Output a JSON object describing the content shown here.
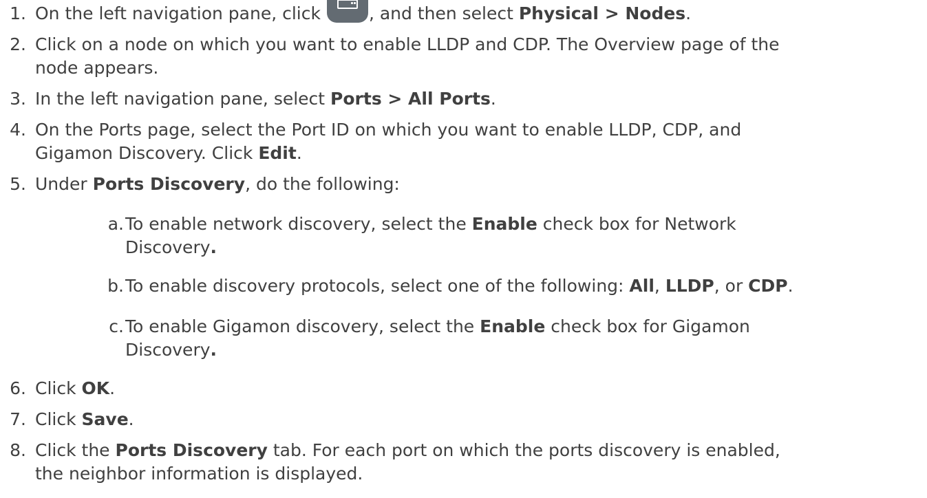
{
  "steps": [
    {
      "num": "1.",
      "a": "On the left navigation pane, click ",
      "b": ", and then select ",
      "c": "Physical > Nodes",
      "d": "."
    },
    {
      "num": "2.",
      "line1": "Click on a node on which you want to enable LLDP and CDP. The Overview page of the",
      "line2": "node appears."
    },
    {
      "num": "3.",
      "a": "In the left navigation pane, select ",
      "b": "Ports > All Ports",
      "c": "."
    },
    {
      "num": "4.",
      "line1": "On the Ports page, select the Port ID on which you want to enable LLDP, CDP, and",
      "line2a": "Gigamon Discovery. Click ",
      "line2b": "Edit",
      "line2c": "."
    },
    {
      "num": "5.",
      "a": "Under ",
      "b": "Ports Discovery",
      "c": ", do the following:"
    },
    {
      "num": "6.",
      "a": "Click ",
      "b": "OK",
      "c": "."
    },
    {
      "num": "7.",
      "a": "Click ",
      "b": "Save",
      "c": "."
    },
    {
      "num": "8.",
      "a": "Click the ",
      "b": "Ports Discovery",
      "c": " tab. For each port on which the ports discovery is enabled,",
      "line2": "the neighbor information is displayed."
    }
  ],
  "substeps": [
    {
      "letter": "a.",
      "a": "To enable network discovery, select the ",
      "b": "Enable",
      "c": " check box for Network",
      "line2a": "Discovery",
      "line2b": "."
    },
    {
      "letter": "b.",
      "a": "To enable discovery protocols, select one of the following: ",
      "b": "All",
      "c": ", ",
      "d": "LLDP",
      "e": ", or ",
      "f": "CDP",
      "g": "."
    },
    {
      "letter": "c.",
      "a": "To enable Gigamon discovery, select the ",
      "b": "Enable",
      "c": " check box for Gigamon",
      "line2a": "Discovery",
      "line2b": "."
    }
  ],
  "icons": {
    "nav_icon": "physical-nodes-icon"
  }
}
